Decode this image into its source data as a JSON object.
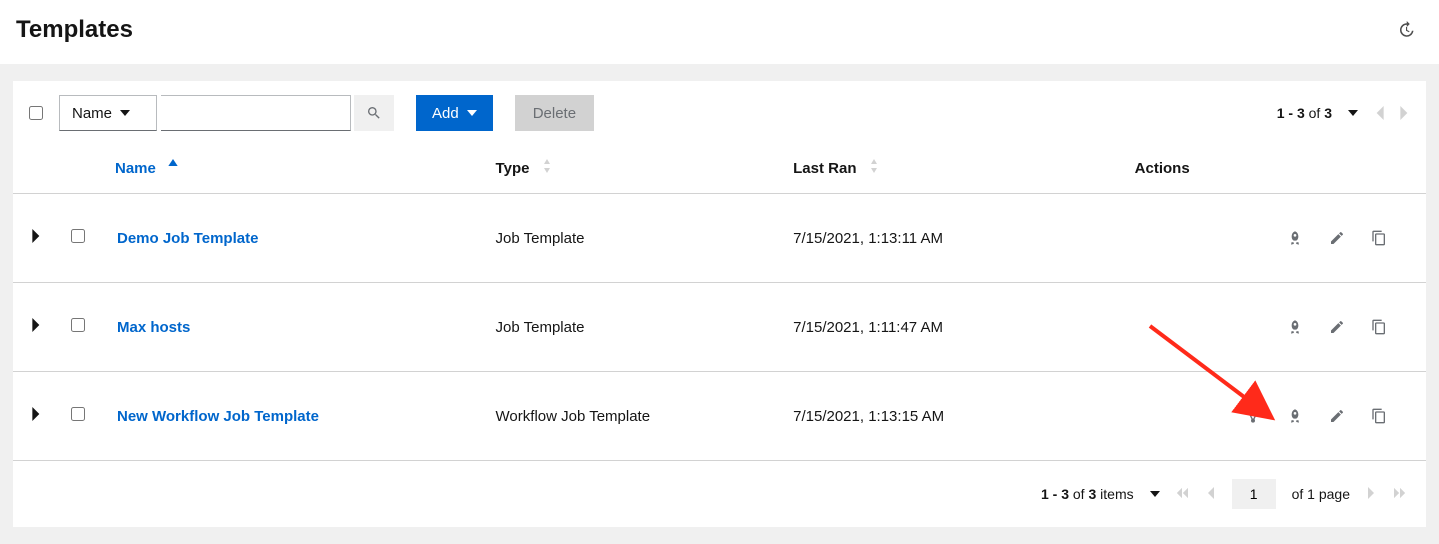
{
  "page_title": "Templates",
  "toolbar": {
    "filter_label": "Name",
    "search_placeholder": "",
    "add_label": "Add",
    "delete_label": "Delete"
  },
  "pagination_top": {
    "range": "1 - 3",
    "of": "of",
    "total": "3"
  },
  "columns": {
    "name": "Name",
    "type": "Type",
    "last_ran": "Last Ran",
    "actions": "Actions"
  },
  "rows": [
    {
      "name": "Demo Job Template",
      "type": "Job Template",
      "last_ran": "7/15/2021, 1:13:11 AM",
      "has_visualizer": false
    },
    {
      "name": "Max hosts",
      "type": "Job Template",
      "last_ran": "7/15/2021, 1:11:47 AM",
      "has_visualizer": false
    },
    {
      "name": "New Workflow Job Template",
      "type": "Workflow Job Template",
      "last_ran": "7/15/2021, 1:13:15 AM",
      "has_visualizer": true
    }
  ],
  "pagination_bottom": {
    "range": "1 - 3",
    "of_items": "of",
    "total_items": "3",
    "items_label": "items",
    "page_value": "1",
    "of_pages": "of 1 page"
  }
}
